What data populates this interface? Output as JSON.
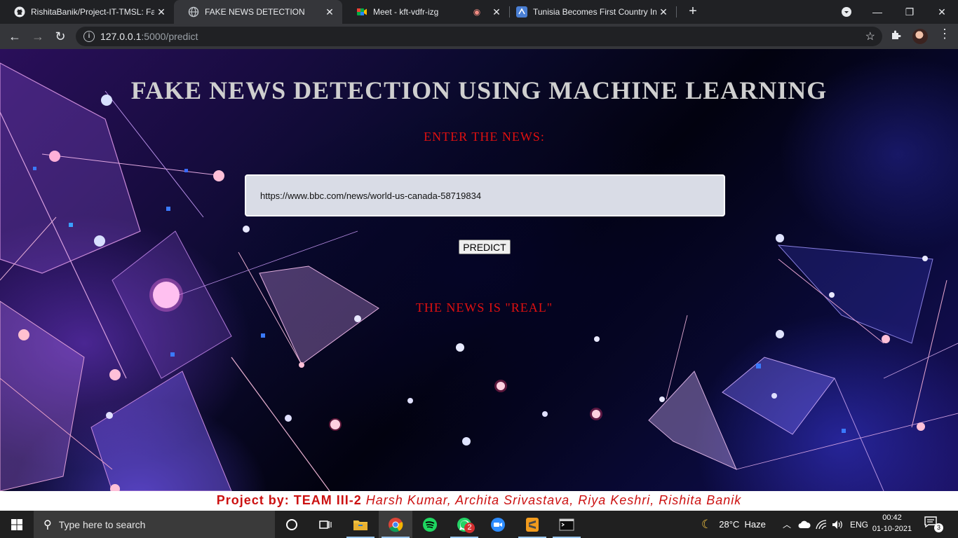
{
  "browser": {
    "tabs": [
      {
        "title": "RishitaBanik/Project-IT-TMSL: Fak",
        "icon": "github-icon",
        "active": false
      },
      {
        "title": "FAKE NEWS DETECTION",
        "icon": "globe-icon",
        "active": true
      },
      {
        "title": "Meet - kft-vdfr-izg",
        "icon": "google-meet-icon",
        "active": false
      },
      {
        "title": "Tunisia Becomes First Country In",
        "icon": "article-icon",
        "active": false
      }
    ],
    "url_host": "127.0.0.1",
    "url_path": ":5000/predict"
  },
  "page": {
    "heading": "FAKE NEWS DETECTION USING MACHINE LEARNING",
    "enter_label": "ENTER THE NEWS:",
    "input_value": "https://www.bbc.com/news/world-us-canada-58719834",
    "predict_label": "PREDICT",
    "result": "THE NEWS IS \"REAL\""
  },
  "footer": {
    "lead": "Project by: TEAM III-2",
    "names": "Harsh Kumar, Archita Srivastava, Riya Keshri, Rishita Banik"
  },
  "taskbar": {
    "search_placeholder": "Type here to search",
    "whatsapp_badge": "2",
    "weather": "28°C  Haze",
    "language": "ENG",
    "time": "00:42",
    "date": "01-10-2021",
    "notification_count": "3"
  },
  "colors": {
    "accent_red": "#e01010",
    "heading_gray": "#cfcfcf"
  }
}
